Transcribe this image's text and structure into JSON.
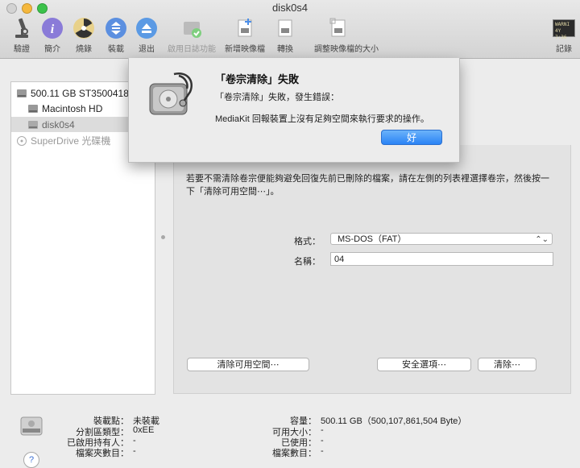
{
  "window": {
    "title": "disk0s4"
  },
  "toolbar": {
    "items": [
      {
        "label": "驗證"
      },
      {
        "label": "簡介"
      },
      {
        "label": "燒錄"
      },
      {
        "label": "裝載"
      },
      {
        "label": "退出"
      },
      {
        "label": "啟用日誌功能"
      },
      {
        "label": "新增映像檔"
      },
      {
        "label": "轉換"
      },
      {
        "label": "調整映像檔的大小"
      }
    ],
    "log_label": "記錄",
    "log_badge_line1": "WARNI",
    "log_badge_line2": "4Y 7:36"
  },
  "sidebar": {
    "items": [
      {
        "label": "500.11 GB ST3500418"
      },
      {
        "label": "Macintosh HD"
      },
      {
        "label": "disk0s4"
      },
      {
        "label": "SuperDrive 光碟機"
      }
    ]
  },
  "erase": {
    "description": "若要不需清除卷宗便能夠避免回復先前已刪除的檔案，請在左側的列表裡選擇卷宗，然後按一下「清除可用空間⋯」。",
    "format_label": "格式：",
    "format_value": "MS-DOS（FAT）",
    "name_label": "名稱：",
    "name_value": "04",
    "erase_free_space_button": "清除可用空間⋯",
    "security_options_button": "安全選項⋯",
    "erase_button": "清除⋯"
  },
  "info": {
    "mount_point_label": "裝載點：",
    "mount_point_value": "未裝載",
    "partition_type_label": "分割區類型：",
    "partition_type_value": "0xEE",
    "owners_label": "已啟用持有人：",
    "owners_value": "-",
    "folder_count_label": "檔案夾數目：",
    "folder_count_value": "-",
    "capacity_label": "容量：",
    "capacity_value": "500.11 GB（500,107,861,504 Byte）",
    "available_label": "可用大小：",
    "available_value": "-",
    "used_label": "已使用：",
    "used_value": "-",
    "file_count_label": "檔案數目：",
    "file_count_value": "-",
    "help_glyph": "?"
  },
  "alert": {
    "title": "「卷宗清除」失敗",
    "message1": "「卷宗清除」失敗，發生錯誤：",
    "message2": "MediaKit 回報裝置上沒有足夠空間來執行要求的操作。",
    "ok_label": "好"
  }
}
